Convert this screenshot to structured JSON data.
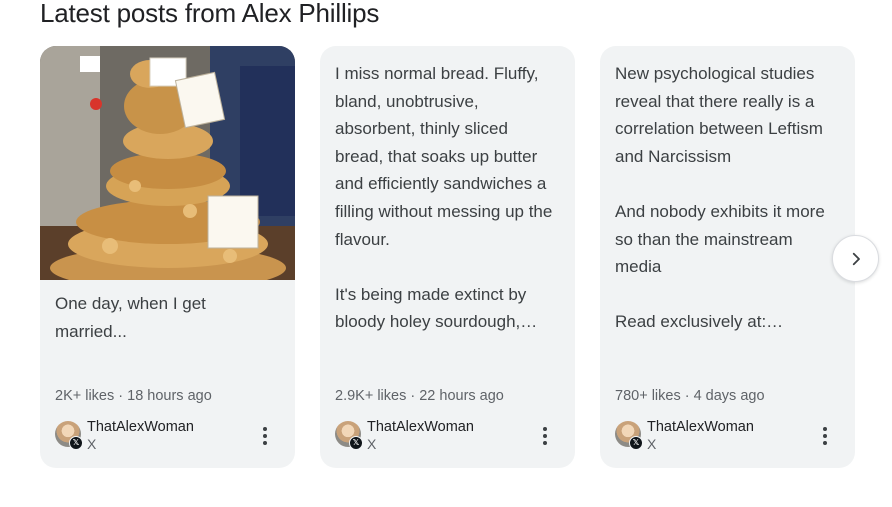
{
  "section": {
    "title": "Latest posts from Alex Phillips"
  },
  "posts": [
    {
      "image_alt": "Tiered pork pie display",
      "text": "One day, when I get\nmarried...",
      "stats": "2K+ likes · 18 hours ago",
      "author": "ThatAlexWoman",
      "source": "X"
    },
    {
      "text": "I miss normal bread. Fluffy,\nbland, unobtrusive,\nabsorbent, thinly sliced\nbread, that soaks up butter\nand efficiently sandwiches a\nfilling without messing up the\nflavour.\n\nIt's being made extinct by\nbloody holey sourdough,…",
      "stats": "2.9K+ likes · 22 hours ago",
      "author": "ThatAlexWoman",
      "source": "X"
    },
    {
      "text": "New psychological studies\nreveal that there really is a\ncorrelation between Leftism\nand Narcissism\n\nAnd nobody exhibits it more\nso than the mainstream\nmedia\n\nRead exclusively at:…",
      "stats": "780+ likes · 4 days ago",
      "author": "ThatAlexWoman",
      "source": "X"
    }
  ],
  "icons": {
    "next": "chevron-right-icon",
    "more": "more-vert-icon",
    "x_badge": "x-logo-icon"
  },
  "colors": {
    "card_bg": "#f1f3f4",
    "text": "#3c4043",
    "muted": "#5f6368"
  }
}
